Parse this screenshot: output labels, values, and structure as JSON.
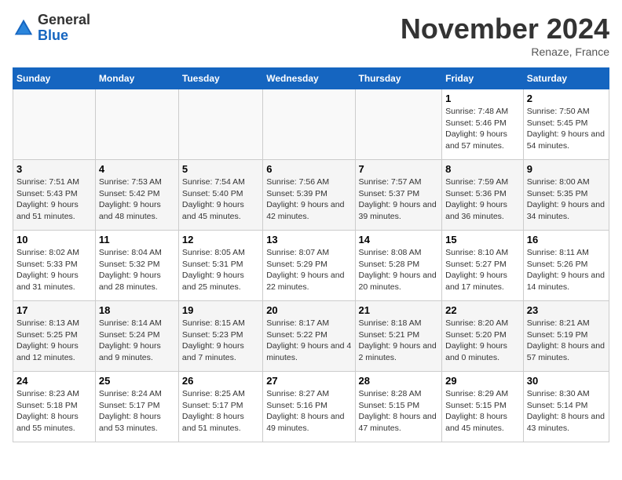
{
  "header": {
    "logo_general": "General",
    "logo_blue": "Blue",
    "month_title": "November 2024",
    "location": "Renaze, France"
  },
  "days_of_week": [
    "Sunday",
    "Monday",
    "Tuesday",
    "Wednesday",
    "Thursday",
    "Friday",
    "Saturday"
  ],
  "weeks": [
    [
      {
        "num": "",
        "empty": true
      },
      {
        "num": "",
        "empty": true
      },
      {
        "num": "",
        "empty": true
      },
      {
        "num": "",
        "empty": true
      },
      {
        "num": "",
        "empty": true
      },
      {
        "num": "1",
        "sunrise": "7:48 AM",
        "sunset": "5:46 PM",
        "daylight": "9 hours and 57 minutes."
      },
      {
        "num": "2",
        "sunrise": "7:50 AM",
        "sunset": "5:45 PM",
        "daylight": "9 hours and 54 minutes."
      }
    ],
    [
      {
        "num": "3",
        "sunrise": "7:51 AM",
        "sunset": "5:43 PM",
        "daylight": "9 hours and 51 minutes."
      },
      {
        "num": "4",
        "sunrise": "7:53 AM",
        "sunset": "5:42 PM",
        "daylight": "9 hours and 48 minutes."
      },
      {
        "num": "5",
        "sunrise": "7:54 AM",
        "sunset": "5:40 PM",
        "daylight": "9 hours and 45 minutes."
      },
      {
        "num": "6",
        "sunrise": "7:56 AM",
        "sunset": "5:39 PM",
        "daylight": "9 hours and 42 minutes."
      },
      {
        "num": "7",
        "sunrise": "7:57 AM",
        "sunset": "5:37 PM",
        "daylight": "9 hours and 39 minutes."
      },
      {
        "num": "8",
        "sunrise": "7:59 AM",
        "sunset": "5:36 PM",
        "daylight": "9 hours and 36 minutes."
      },
      {
        "num": "9",
        "sunrise": "8:00 AM",
        "sunset": "5:35 PM",
        "daylight": "9 hours and 34 minutes."
      }
    ],
    [
      {
        "num": "10",
        "sunrise": "8:02 AM",
        "sunset": "5:33 PM",
        "daylight": "9 hours and 31 minutes."
      },
      {
        "num": "11",
        "sunrise": "8:04 AM",
        "sunset": "5:32 PM",
        "daylight": "9 hours and 28 minutes."
      },
      {
        "num": "12",
        "sunrise": "8:05 AM",
        "sunset": "5:31 PM",
        "daylight": "9 hours and 25 minutes."
      },
      {
        "num": "13",
        "sunrise": "8:07 AM",
        "sunset": "5:29 PM",
        "daylight": "9 hours and 22 minutes."
      },
      {
        "num": "14",
        "sunrise": "8:08 AM",
        "sunset": "5:28 PM",
        "daylight": "9 hours and 20 minutes."
      },
      {
        "num": "15",
        "sunrise": "8:10 AM",
        "sunset": "5:27 PM",
        "daylight": "9 hours and 17 minutes."
      },
      {
        "num": "16",
        "sunrise": "8:11 AM",
        "sunset": "5:26 PM",
        "daylight": "9 hours and 14 minutes."
      }
    ],
    [
      {
        "num": "17",
        "sunrise": "8:13 AM",
        "sunset": "5:25 PM",
        "daylight": "9 hours and 12 minutes."
      },
      {
        "num": "18",
        "sunrise": "8:14 AM",
        "sunset": "5:24 PM",
        "daylight": "9 hours and 9 minutes."
      },
      {
        "num": "19",
        "sunrise": "8:15 AM",
        "sunset": "5:23 PM",
        "daylight": "9 hours and 7 minutes."
      },
      {
        "num": "20",
        "sunrise": "8:17 AM",
        "sunset": "5:22 PM",
        "daylight": "9 hours and 4 minutes."
      },
      {
        "num": "21",
        "sunrise": "8:18 AM",
        "sunset": "5:21 PM",
        "daylight": "9 hours and 2 minutes."
      },
      {
        "num": "22",
        "sunrise": "8:20 AM",
        "sunset": "5:20 PM",
        "daylight": "9 hours and 0 minutes."
      },
      {
        "num": "23",
        "sunrise": "8:21 AM",
        "sunset": "5:19 PM",
        "daylight": "8 hours and 57 minutes."
      }
    ],
    [
      {
        "num": "24",
        "sunrise": "8:23 AM",
        "sunset": "5:18 PM",
        "daylight": "8 hours and 55 minutes."
      },
      {
        "num": "25",
        "sunrise": "8:24 AM",
        "sunset": "5:17 PM",
        "daylight": "8 hours and 53 minutes."
      },
      {
        "num": "26",
        "sunrise": "8:25 AM",
        "sunset": "5:17 PM",
        "daylight": "8 hours and 51 minutes."
      },
      {
        "num": "27",
        "sunrise": "8:27 AM",
        "sunset": "5:16 PM",
        "daylight": "8 hours and 49 minutes."
      },
      {
        "num": "28",
        "sunrise": "8:28 AM",
        "sunset": "5:15 PM",
        "daylight": "8 hours and 47 minutes."
      },
      {
        "num": "29",
        "sunrise": "8:29 AM",
        "sunset": "5:15 PM",
        "daylight": "8 hours and 45 minutes."
      },
      {
        "num": "30",
        "sunrise": "8:30 AM",
        "sunset": "5:14 PM",
        "daylight": "8 hours and 43 minutes."
      }
    ]
  ],
  "labels": {
    "sunrise": "Sunrise:",
    "sunset": "Sunset:",
    "daylight": "Daylight:"
  }
}
